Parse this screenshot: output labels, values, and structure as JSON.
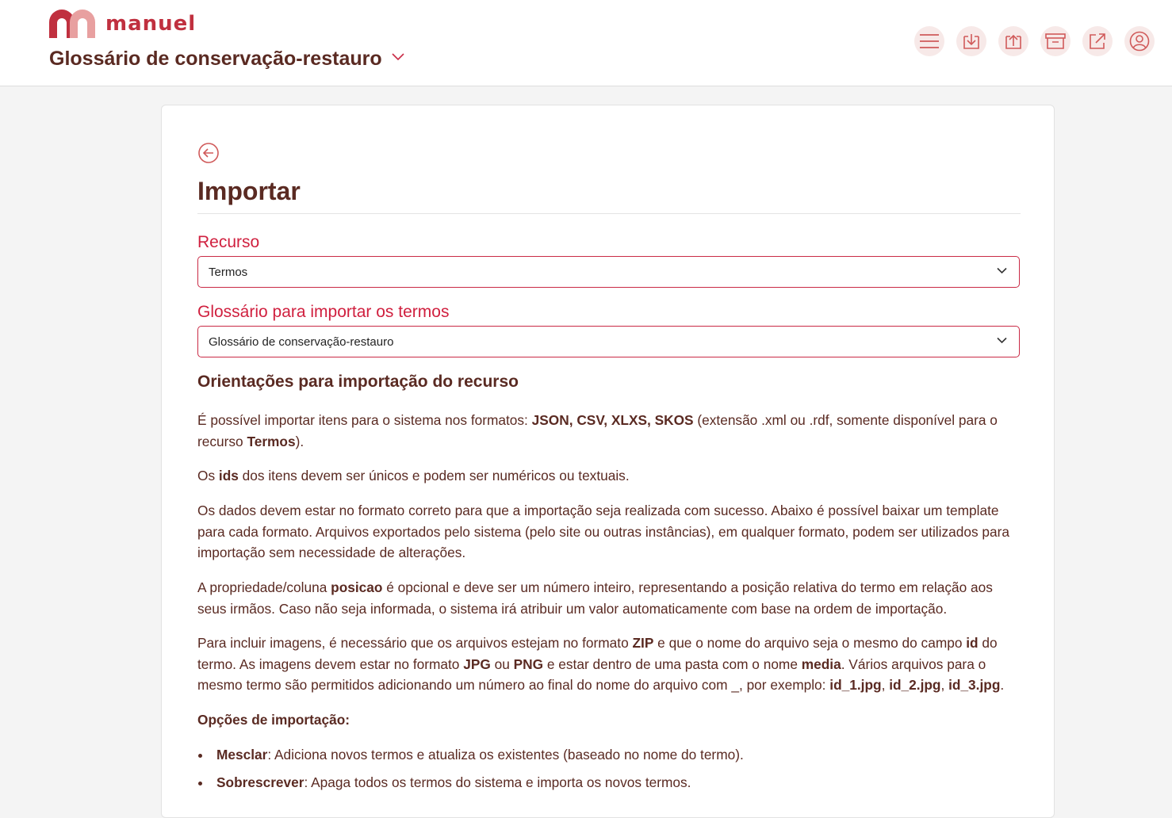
{
  "header": {
    "brand": "manuel",
    "glossary_title": "Glossário de conservação-restauro",
    "icons": [
      "menu-icon",
      "download-icon",
      "upload-icon",
      "archive-icon",
      "external-link-icon",
      "user-icon"
    ]
  },
  "page": {
    "title": "Importar",
    "resource_label": "Recurso",
    "resource_value": "Termos",
    "glossary_label": "Glossário para importar os termos",
    "glossary_value": "Glossário de conservação-restauro",
    "section_title": "Orientações para importação do recurso",
    "p1": {
      "a": "É possível importar itens para o sistema nos formatos: ",
      "b": "JSON, CSV, XLXS, SKOS",
      "c": " (extensão .xml ou .rdf, somente disponível para o recurso ",
      "d": "Termos",
      "e": ")."
    },
    "p2": {
      "a": "Os ",
      "b": "ids",
      "c": " dos itens devem ser únicos e podem ser numéricos ou textuais."
    },
    "p3": "Os dados devem estar no formato correto para que a importação seja realizada com sucesso. Abaixo é possível baixar um template para cada formato. Arquivos exportados pelo sistema (pelo site ou outras instâncias), em qualquer formato, podem ser utilizados para importação sem necessidade de alterações.",
    "p4": {
      "a": "A propriedade/coluna ",
      "b": "posicao",
      "c": " é opcional e deve ser um número inteiro, representando a posição relativa do termo em relação aos seus irmãos. Caso não seja informada, o sistema irá atribuir um valor automaticamente com base na ordem de importação."
    },
    "p5": {
      "a": "Para incluir imagens, é necessário que os arquivos estejam no formato ",
      "b": "ZIP",
      "c": " e que o nome do arquivo seja o mesmo do campo ",
      "d": "id",
      "e": " do termo. As imagens devem estar no formato ",
      "f": "JPG",
      "g": " ou ",
      "h": "PNG",
      "i": " e estar dentro de uma pasta com o nome ",
      "j": "media",
      "k": ". Vários arquivos para o mesmo termo são permitidos adicionando um número ao final do nome do arquivo com _, por exemplo: ",
      "l": "id_1.jpg",
      "m": ", ",
      "n": "id_2.jpg",
      "o": ", ",
      "p": "id_3.jpg",
      "q": "."
    },
    "options_title": "Opções de importação:",
    "options": [
      {
        "name": "Mesclar",
        "desc": ": Adiciona novos termos e atualiza os existentes (baseado no nome do termo)."
      },
      {
        "name": "Sobrescrever",
        "desc": ": Apaga todos os termos do sistema e importa os novos termos."
      }
    ]
  },
  "colors": {
    "accent": "#c92a45",
    "text": "#5a2a22",
    "icon_bg": "#f7e9e8"
  }
}
